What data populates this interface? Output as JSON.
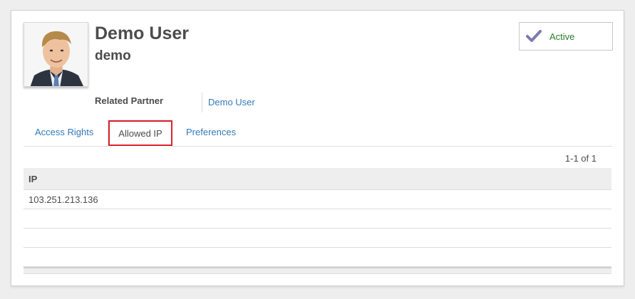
{
  "user": {
    "name": "Demo User",
    "login": "demo",
    "avatar_icon": "user-photo"
  },
  "status": {
    "label": "Active",
    "icon": "check-icon",
    "icon_color": "#7c7bad",
    "label_color": "#2b7a2b"
  },
  "fields": {
    "related_partner_label": "Related Partner",
    "related_partner_value": "Demo User"
  },
  "tabs": [
    {
      "label": "Access Rights",
      "active": false
    },
    {
      "label": "Allowed IP",
      "active": true
    },
    {
      "label": "Preferences",
      "active": false
    }
  ],
  "pager": "1-1 of 1",
  "table": {
    "columns": [
      "IP"
    ],
    "rows": [
      [
        "103.251.213.136"
      ],
      [
        ""
      ],
      [
        ""
      ],
      [
        ""
      ]
    ]
  },
  "colors": {
    "link": "#337ab7",
    "highlight_border": "#d9232d"
  }
}
